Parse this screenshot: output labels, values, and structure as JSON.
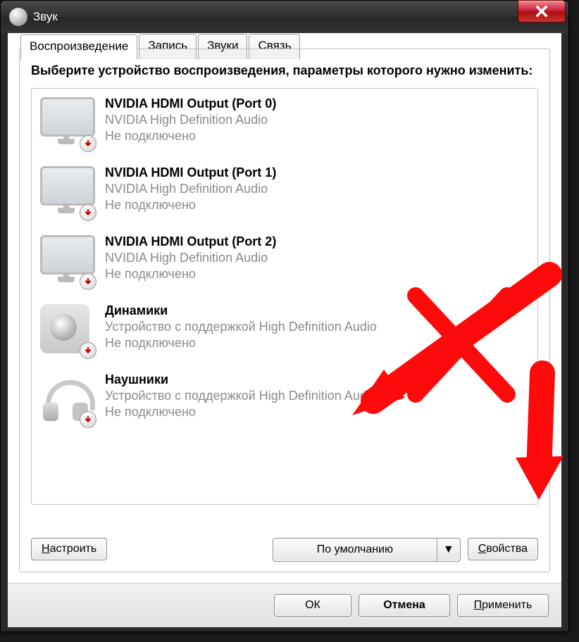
{
  "title": "Звук",
  "tabs": [
    {
      "label": "Воспроизведение",
      "active": true
    },
    {
      "label": "Запись",
      "active": false
    },
    {
      "label": "Звуки",
      "active": false
    },
    {
      "label": "Связь",
      "active": false
    }
  ],
  "instruction": "Выберите устройство воспроизведения, параметры которого нужно изменить:",
  "devices": [
    {
      "name": "NVIDIA HDMI Output (Port 0)",
      "driver": "NVIDIA High Definition Audio",
      "status": "Не подключено",
      "icon": "monitor"
    },
    {
      "name": "NVIDIA HDMI Output (Port 1)",
      "driver": "NVIDIA High Definition Audio",
      "status": "Не подключено",
      "icon": "monitor"
    },
    {
      "name": "NVIDIA HDMI Output (Port 2)",
      "driver": "NVIDIA High Definition Audio",
      "status": "Не подключено",
      "icon": "monitor"
    },
    {
      "name": "Динамики",
      "driver": "Устройство с поддержкой High Definition Audio",
      "status": "Не подключено",
      "icon": "speaker"
    },
    {
      "name": "Наушники",
      "driver": "Устройство с поддержкой High Definition Audio",
      "status": "Не подключено",
      "icon": "headphones"
    }
  ],
  "buttons": {
    "configure": "Настроить",
    "default": "По умолчанию",
    "properties": "Свойства",
    "ok": "ОК",
    "cancel": "Отмена",
    "apply": "Применить"
  }
}
